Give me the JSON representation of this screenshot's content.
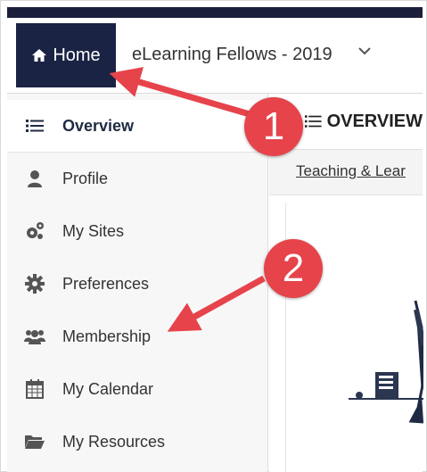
{
  "header": {
    "home_label": "Home",
    "site_title": "eLearning Fellows - 2019"
  },
  "sidebar": {
    "items": [
      {
        "label": "Overview",
        "icon": "list-icon",
        "active": true
      },
      {
        "label": "Profile",
        "icon": "user-icon"
      },
      {
        "label": "My Sites",
        "icon": "gears-icon"
      },
      {
        "label": "Preferences",
        "icon": "gear-icon"
      },
      {
        "label": "Membership",
        "icon": "users-icon"
      },
      {
        "label": "My Calendar",
        "icon": "calendar-icon"
      },
      {
        "label": "My Resources",
        "icon": "folder-open-icon"
      }
    ]
  },
  "main": {
    "heading": "OVERVIEW",
    "tab_link": "Teaching & Lear"
  },
  "callouts": {
    "one": "1",
    "two": "2"
  },
  "colors": {
    "brand_dark": "#1b2344",
    "callout_red": "#e6434b"
  }
}
